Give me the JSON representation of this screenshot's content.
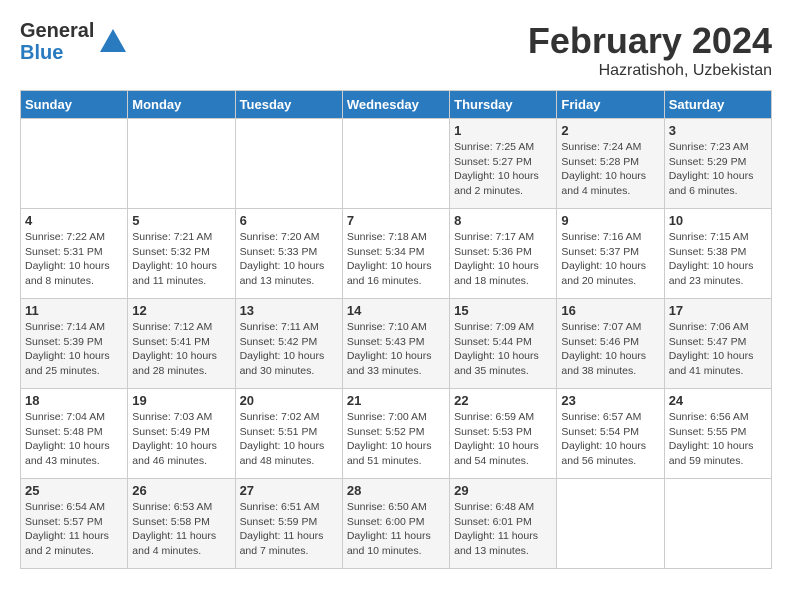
{
  "logo": {
    "general": "General",
    "blue": "Blue"
  },
  "header": {
    "month": "February 2024",
    "location": "Hazratishoh, Uzbekistan"
  },
  "weekdays": [
    "Sunday",
    "Monday",
    "Tuesday",
    "Wednesday",
    "Thursday",
    "Friday",
    "Saturday"
  ],
  "weeks": [
    [
      {
        "day": "",
        "info": ""
      },
      {
        "day": "",
        "info": ""
      },
      {
        "day": "",
        "info": ""
      },
      {
        "day": "",
        "info": ""
      },
      {
        "day": "1",
        "info": "Sunrise: 7:25 AM\nSunset: 5:27 PM\nDaylight: 10 hours\nand 2 minutes."
      },
      {
        "day": "2",
        "info": "Sunrise: 7:24 AM\nSunset: 5:28 PM\nDaylight: 10 hours\nand 4 minutes."
      },
      {
        "day": "3",
        "info": "Sunrise: 7:23 AM\nSunset: 5:29 PM\nDaylight: 10 hours\nand 6 minutes."
      }
    ],
    [
      {
        "day": "4",
        "info": "Sunrise: 7:22 AM\nSunset: 5:31 PM\nDaylight: 10 hours\nand 8 minutes."
      },
      {
        "day": "5",
        "info": "Sunrise: 7:21 AM\nSunset: 5:32 PM\nDaylight: 10 hours\nand 11 minutes."
      },
      {
        "day": "6",
        "info": "Sunrise: 7:20 AM\nSunset: 5:33 PM\nDaylight: 10 hours\nand 13 minutes."
      },
      {
        "day": "7",
        "info": "Sunrise: 7:18 AM\nSunset: 5:34 PM\nDaylight: 10 hours\nand 16 minutes."
      },
      {
        "day": "8",
        "info": "Sunrise: 7:17 AM\nSunset: 5:36 PM\nDaylight: 10 hours\nand 18 minutes."
      },
      {
        "day": "9",
        "info": "Sunrise: 7:16 AM\nSunset: 5:37 PM\nDaylight: 10 hours\nand 20 minutes."
      },
      {
        "day": "10",
        "info": "Sunrise: 7:15 AM\nSunset: 5:38 PM\nDaylight: 10 hours\nand 23 minutes."
      }
    ],
    [
      {
        "day": "11",
        "info": "Sunrise: 7:14 AM\nSunset: 5:39 PM\nDaylight: 10 hours\nand 25 minutes."
      },
      {
        "day": "12",
        "info": "Sunrise: 7:12 AM\nSunset: 5:41 PM\nDaylight: 10 hours\nand 28 minutes."
      },
      {
        "day": "13",
        "info": "Sunrise: 7:11 AM\nSunset: 5:42 PM\nDaylight: 10 hours\nand 30 minutes."
      },
      {
        "day": "14",
        "info": "Sunrise: 7:10 AM\nSunset: 5:43 PM\nDaylight: 10 hours\nand 33 minutes."
      },
      {
        "day": "15",
        "info": "Sunrise: 7:09 AM\nSunset: 5:44 PM\nDaylight: 10 hours\nand 35 minutes."
      },
      {
        "day": "16",
        "info": "Sunrise: 7:07 AM\nSunset: 5:46 PM\nDaylight: 10 hours\nand 38 minutes."
      },
      {
        "day": "17",
        "info": "Sunrise: 7:06 AM\nSunset: 5:47 PM\nDaylight: 10 hours\nand 41 minutes."
      }
    ],
    [
      {
        "day": "18",
        "info": "Sunrise: 7:04 AM\nSunset: 5:48 PM\nDaylight: 10 hours\nand 43 minutes."
      },
      {
        "day": "19",
        "info": "Sunrise: 7:03 AM\nSunset: 5:49 PM\nDaylight: 10 hours\nand 46 minutes."
      },
      {
        "day": "20",
        "info": "Sunrise: 7:02 AM\nSunset: 5:51 PM\nDaylight: 10 hours\nand 48 minutes."
      },
      {
        "day": "21",
        "info": "Sunrise: 7:00 AM\nSunset: 5:52 PM\nDaylight: 10 hours\nand 51 minutes."
      },
      {
        "day": "22",
        "info": "Sunrise: 6:59 AM\nSunset: 5:53 PM\nDaylight: 10 hours\nand 54 minutes."
      },
      {
        "day": "23",
        "info": "Sunrise: 6:57 AM\nSunset: 5:54 PM\nDaylight: 10 hours\nand 56 minutes."
      },
      {
        "day": "24",
        "info": "Sunrise: 6:56 AM\nSunset: 5:55 PM\nDaylight: 10 hours\nand 59 minutes."
      }
    ],
    [
      {
        "day": "25",
        "info": "Sunrise: 6:54 AM\nSunset: 5:57 PM\nDaylight: 11 hours\nand 2 minutes."
      },
      {
        "day": "26",
        "info": "Sunrise: 6:53 AM\nSunset: 5:58 PM\nDaylight: 11 hours\nand 4 minutes."
      },
      {
        "day": "27",
        "info": "Sunrise: 6:51 AM\nSunset: 5:59 PM\nDaylight: 11 hours\nand 7 minutes."
      },
      {
        "day": "28",
        "info": "Sunrise: 6:50 AM\nSunset: 6:00 PM\nDaylight: 11 hours\nand 10 minutes."
      },
      {
        "day": "29",
        "info": "Sunrise: 6:48 AM\nSunset: 6:01 PM\nDaylight: 11 hours\nand 13 minutes."
      },
      {
        "day": "",
        "info": ""
      },
      {
        "day": "",
        "info": ""
      }
    ]
  ]
}
